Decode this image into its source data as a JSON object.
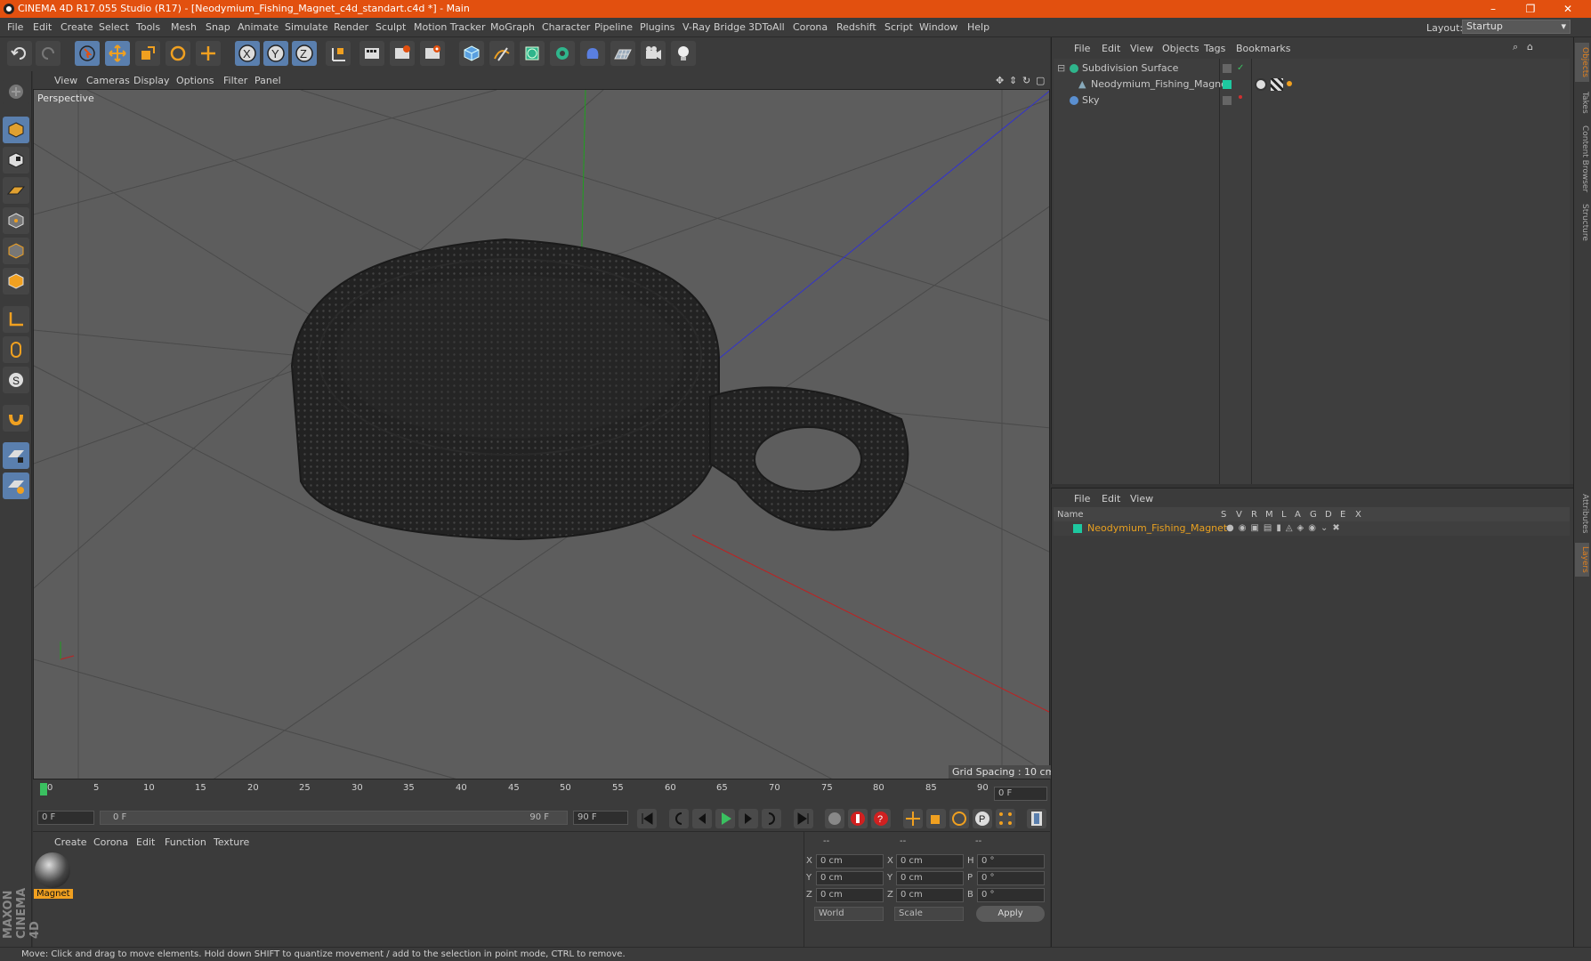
{
  "window": {
    "title": "CINEMA 4D R17.055 Studio (R17) - [Neodymium_Fishing_Magnet_c4d_standart.c4d *] - Main"
  },
  "menu": [
    "File",
    "Edit",
    "Create",
    "Select",
    "Tools",
    "Mesh",
    "Snap",
    "Animate",
    "Simulate",
    "Render",
    "Sculpt",
    "Motion Tracker",
    "MoGraph",
    "Character",
    "Pipeline",
    "Plugins",
    "V-Ray Bridge",
    "3DToAll",
    "Corona",
    "Redshift",
    "Script",
    "Window",
    "Help"
  ],
  "layout": {
    "label": "Layout:",
    "value": "Startup"
  },
  "viewport": {
    "menu": [
      "View",
      "Cameras",
      "Display",
      "Options",
      "Filter",
      "Panel"
    ],
    "camera_label": "Perspective",
    "grid_spacing": "Grid Spacing : 10 cm"
  },
  "timeline": {
    "ticks": [
      "0",
      "5",
      "10",
      "15",
      "20",
      "25",
      "30",
      "35",
      "40",
      "45",
      "50",
      "55",
      "60",
      "65",
      "70",
      "75",
      "80",
      "85",
      "90"
    ],
    "current_frame": "0 F",
    "start_field": "0 F",
    "range_start": "0 F",
    "range_end": "90 F",
    "end_field": "90 F"
  },
  "material_panel": {
    "menu": [
      "Create",
      "Corona",
      "Edit",
      "Function",
      "Texture"
    ],
    "materials": [
      {
        "name": "Magnet"
      }
    ]
  },
  "coords": {
    "headers": [
      "--",
      "--",
      "--"
    ],
    "rows": [
      {
        "a": "X",
        "v1": "0 cm",
        "b": "X",
        "v2": "0 cm",
        "c": "H",
        "v3": "0 °"
      },
      {
        "a": "Y",
        "v1": "0 cm",
        "b": "Y",
        "v2": "0 cm",
        "c": "P",
        "v3": "0 °"
      },
      {
        "a": "Z",
        "v1": "0 cm",
        "b": "Z",
        "v2": "0 cm",
        "c": "B",
        "v3": "0 °"
      }
    ],
    "mode1": "World",
    "mode2": "Scale",
    "apply_label": "Apply"
  },
  "status": "Move: Click and drag to move elements. Hold down SHIFT to quantize movement / add to the selection in point mode, CTRL to remove.",
  "objects_panel": {
    "menu": [
      "File",
      "Edit",
      "View",
      "Objects",
      "Tags",
      "Bookmarks"
    ],
    "items": [
      {
        "name": "Subdivision Surface",
        "color": "#c8c8c8"
      },
      {
        "name": "Neodymium_Fishing_Magnet",
        "color": "#c8c8c8"
      },
      {
        "name": "Sky",
        "color": "#c8c8c8"
      }
    ]
  },
  "layers_panel": {
    "menu": [
      "File",
      "Edit",
      "View"
    ],
    "columns": [
      "Name",
      "S",
      "V",
      "R",
      "M",
      "L",
      "A",
      "G",
      "D",
      "E",
      "X"
    ],
    "items": [
      {
        "name": "Neodymium_Fishing_Magnet",
        "color": "#e8a020"
      }
    ]
  },
  "right_tabs": [
    "Objects",
    "Takes",
    "Content Browser",
    "Structure",
    "Attributes",
    "Layers"
  ],
  "brand": "MAXON CINEMA 4D",
  "colors": {
    "accent": "#e2500f",
    "selected": "#5a7fae",
    "layer": "#e8a020",
    "object_tag": "#1ec8a0"
  }
}
